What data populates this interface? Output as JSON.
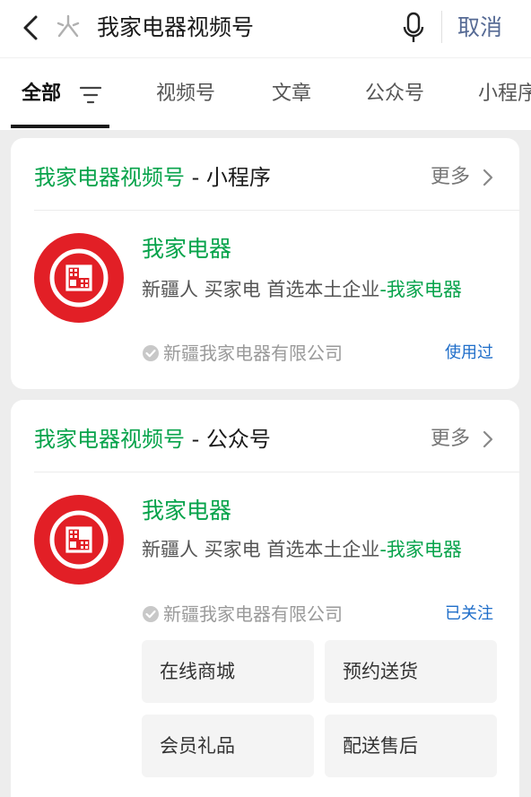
{
  "header": {
    "search_query": "我家电器视频号",
    "cancel_label": "取消"
  },
  "tabs": [
    "全部",
    "视频号",
    "文章",
    "公众号",
    "小程序"
  ],
  "sections": [
    {
      "title_highlight": "我家电器视频号",
      "title_rest": " - 小程序",
      "more_label": "更多",
      "name": "我家电器",
      "desc_plain": "新疆人 买家电 首选本土企业",
      "desc_highlight": "-我家电器",
      "company": "新疆我家电器有限公司",
      "status": "使用过"
    },
    {
      "title_highlight": "我家电器视频号",
      "title_rest": " - 公众号",
      "more_label": "更多",
      "name": "我家电器",
      "desc_plain": "新疆人 买家电 首选本土企业",
      "desc_highlight": "-我家电器",
      "company": "新疆我家电器有限公司",
      "status": "已关注",
      "menu": [
        "在线商城",
        "预约送货",
        "会员礼品",
        "配送售后"
      ]
    }
  ],
  "colors": {
    "accent_green": "#07a34b",
    "link_blue": "#1e6dc9",
    "logo_red": "#e21f26"
  }
}
